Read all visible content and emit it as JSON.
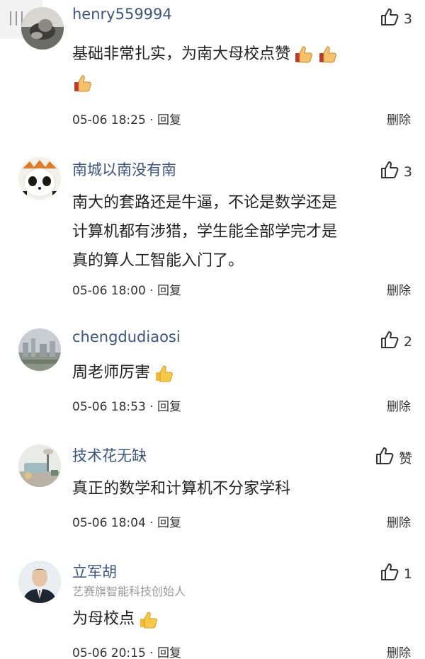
{
  "menu_icon": "menu-lines-icon",
  "comments": [
    {
      "user": "henry559994",
      "subtitle": "",
      "likes": "3",
      "lines": [
        "基础非常扎实，为南大母校点赞"
      ],
      "emoji_icons": [
        "thumbs-up-emoji",
        "thumbs-up-emoji",
        "thumbs-up-emoji"
      ],
      "time": "05-06 18:25",
      "sep": " · ",
      "reply": "回复",
      "delete": "删除"
    },
    {
      "user": "南城以南没有南",
      "subtitle": "",
      "likes": "3",
      "lines": [
        "南大的套路还是牛逼，不论是数学还是",
        "计算机都有涉猎，学生能全部学完才是",
        "真的算人工智能入门了。"
      ],
      "time": "05-06 18:00",
      "sep": " · ",
      "reply": "回复",
      "delete": "删除"
    },
    {
      "user": "chengdudiaosi",
      "subtitle": "",
      "likes": "2",
      "lines": [
        "周老师厉害"
      ],
      "emoji_icons": [
        "thumbs-up-emoji"
      ],
      "time": "05-06 18:53",
      "sep": " · ",
      "reply": "回复",
      "delete": "删除"
    },
    {
      "user": "技术花无缺",
      "subtitle": "",
      "likes": "赞",
      "lines": [
        "真正的数学和计算机不分家学科"
      ],
      "time": "05-06 18:04",
      "sep": " · ",
      "reply": "回复",
      "delete": "删除"
    },
    {
      "user": "立军胡",
      "subtitle": "艺赛旗智能科技创始人",
      "likes": "1",
      "lines": [
        "为母校点"
      ],
      "emoji_icons": [
        "thumbs-up-emoji"
      ],
      "time": "05-06 20:15",
      "sep": " · ",
      "reply": "回复",
      "delete": "删除"
    }
  ],
  "colors": {
    "username": "#3b5584",
    "text": "#222222",
    "meta": "#333333",
    "subtitle": "#9a9a9a"
  }
}
